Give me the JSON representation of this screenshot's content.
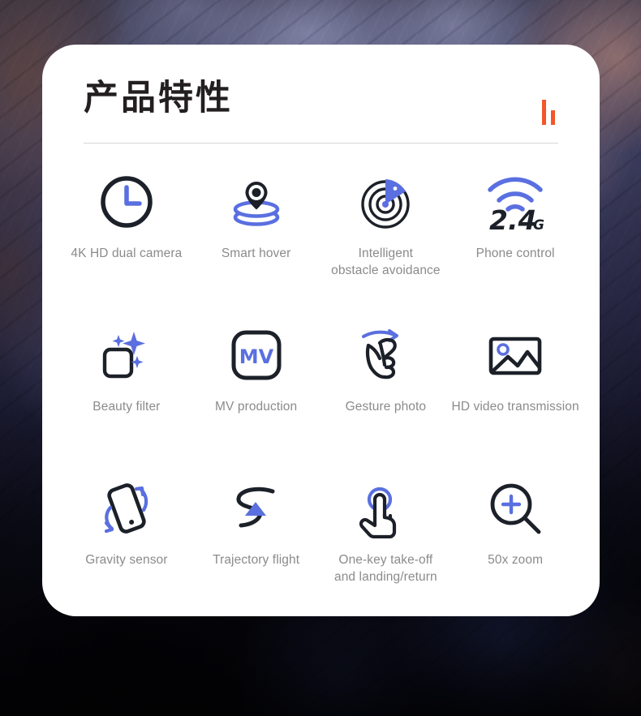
{
  "background": {
    "description": "dark rocky mountain photograph",
    "top_tone": "#4b4a63",
    "bottom_tone": "#08080f"
  },
  "card": {
    "background_color": "#ffffff",
    "header": {
      "title": "产品特性",
      "accent_color": "#f4562a",
      "accent_bars": [
        {
          "name": "tall-bar",
          "height": 31
        },
        {
          "name": "short-bar",
          "height": 18
        }
      ]
    },
    "divider_color": "#d8d8d8"
  },
  "theme": {
    "dark_ink": "#1c2029",
    "accent_blue": "#5a6fe0",
    "label_gray": "#8b8b8b",
    "orange": "#f4562a"
  },
  "features": [
    {
      "icon": "clock-icon",
      "label": "4K HD dual camera"
    },
    {
      "icon": "hover-pin-icon",
      "label": "Smart hover"
    },
    {
      "icon": "radar-icon",
      "label": "Intelligent\nobstacle avoidance"
    },
    {
      "icon": "wifi-24g-icon",
      "label": "Phone control",
      "badge": "2.4",
      "badge_suffix": "G"
    },
    {
      "icon": "beauty-sparkle-icon",
      "label": "Beauty filter"
    },
    {
      "icon": "mv-badge-icon",
      "label": "MV production",
      "badge": "MV"
    },
    {
      "icon": "gesture-hand-icon",
      "label": "Gesture photo"
    },
    {
      "icon": "photo-frame-icon",
      "label": "HD video transmission"
    },
    {
      "icon": "tilted-phone-icon",
      "label": "Gravity sensor"
    },
    {
      "icon": "s-path-icon",
      "label": "Trajectory flight"
    },
    {
      "icon": "tap-hand-icon",
      "label": "One-key take-off\nand landing/return"
    },
    {
      "icon": "magnifier-plus-icon",
      "label": "50x zoom"
    }
  ]
}
